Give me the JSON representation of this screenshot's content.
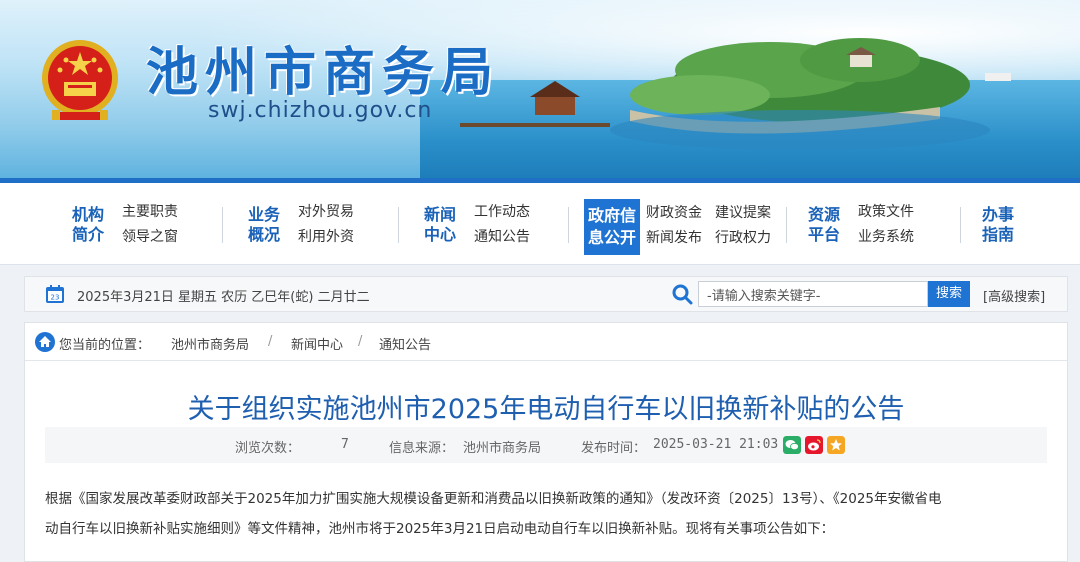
{
  "header": {
    "title": "池州市商务局",
    "url": "swj.chizhou.gov.cn"
  },
  "nav": {
    "items": [
      {
        "main": [
          "机构",
          "简介"
        ],
        "subs": [
          "主要职责",
          "领导之窗"
        ]
      },
      {
        "main": [
          "业务",
          "概况"
        ],
        "subs": [
          "对外贸易",
          "利用外资"
        ]
      },
      {
        "main": [
          "新闻",
          "中心"
        ],
        "subs": [
          "工作动态",
          "通知公告"
        ]
      },
      {
        "main": [
          "政府信",
          "息公开"
        ],
        "subs": [
          "财政资金",
          "新闻发布"
        ],
        "subs2": [
          "建议提案",
          "行政权力"
        ],
        "active": true
      },
      {
        "main": [
          "资源",
          "平台"
        ],
        "subs": [
          "政策文件",
          "业务系统"
        ]
      },
      {
        "main": [
          "办事",
          "指南"
        ],
        "subs": []
      }
    ]
  },
  "infobar": {
    "date": "2025年3月21日 星期五 农历 乙巳年(蛇) 二月廿二",
    "search_placeholder": "-请输入搜索关键字-",
    "search_button": "搜索",
    "advanced_search": "[高级搜索]"
  },
  "breadcrumb": {
    "label": "您当前的位置：",
    "items": [
      "池州市商务局",
      "新闻中心",
      "通知公告"
    ]
  },
  "article": {
    "title": "关于组织实施池州市2025年电动自行车以旧换新补贴的公告",
    "views_label": "浏览次数：",
    "views": "7",
    "source_label": "信息来源：",
    "source": "池州市商务局",
    "published_label": "发布时间：",
    "published": "2025-03-21 21:03",
    "paragraph_line1": "根据《国家发展改革委财政部关于2025年加力扩围实施大规模设备更新和消费品以旧换新政策的通知》（发改环资〔2025〕13号）、《2025年安徽省电",
    "paragraph_line2": "动自行车以旧换新补贴实施细则》等文件精神，池州市将于2025年3月21日启动电动自行车以旧换新补贴。现将有关事项公告如下："
  },
  "colors": {
    "brand_blue": "#1f73d2",
    "title_blue": "#1f5fb0",
    "wechat_green": "#2aae67",
    "weibo_red": "#e6162d",
    "qzone_orange": "#f5a623"
  }
}
